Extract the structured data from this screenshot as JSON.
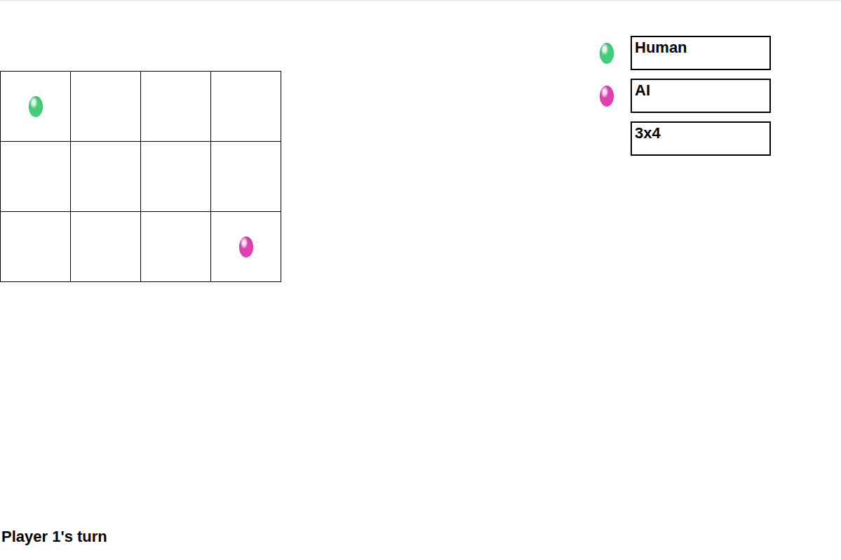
{
  "board": {
    "rows": [
      [
        {
          "gem": true,
          "color": "#44cc77"
        },
        {
          "gem": false
        },
        {
          "gem": false
        },
        {
          "gem": false
        }
      ],
      [
        {
          "gem": false
        },
        {
          "gem": false
        },
        {
          "gem": false
        },
        {
          "gem": false
        }
      ],
      [
        {
          "gem": false
        },
        {
          "gem": false
        },
        {
          "gem": false
        },
        {
          "gem": true,
          "color": "#e040b0"
        }
      ]
    ]
  },
  "players": [
    {
      "name": "Human",
      "color": "#44cc77"
    },
    {
      "name": "AI",
      "color": "#e040b0"
    }
  ],
  "board_size": "3x4",
  "status": "Player 1's turn"
}
